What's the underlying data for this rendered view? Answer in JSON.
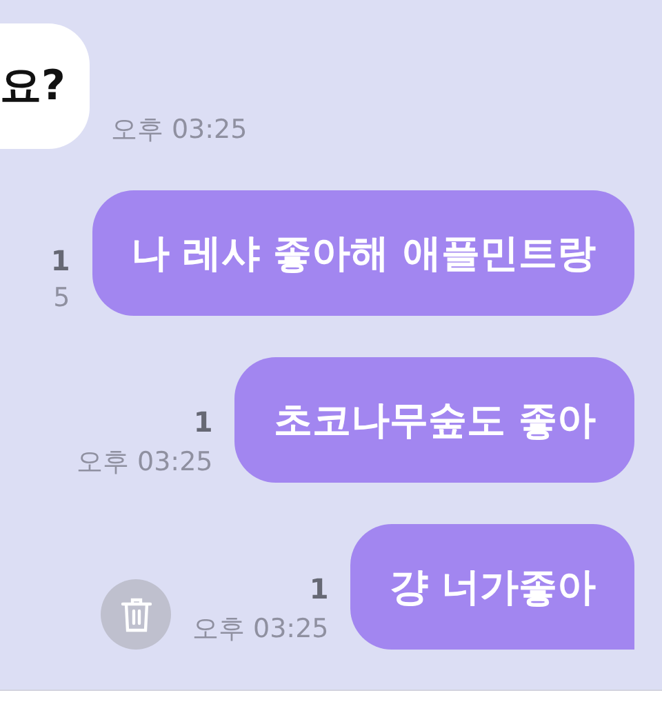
{
  "messages": [
    {
      "kind": "received",
      "text": "요?",
      "time": "오후 03:25"
    },
    {
      "kind": "sent",
      "text": "나 레샤 좋아해 애플민트랑",
      "read_count": "1",
      "time": "5",
      "tail": false,
      "deletable": false
    },
    {
      "kind": "sent",
      "text": "초코나무숲도 좋아",
      "read_count": "1",
      "time": "오후 03:25",
      "tail": false,
      "deletable": false
    },
    {
      "kind": "sent",
      "text": "걍 너가좋아",
      "read_count": "1",
      "time": "오후 03:25",
      "tail": true,
      "deletable": true
    }
  ]
}
